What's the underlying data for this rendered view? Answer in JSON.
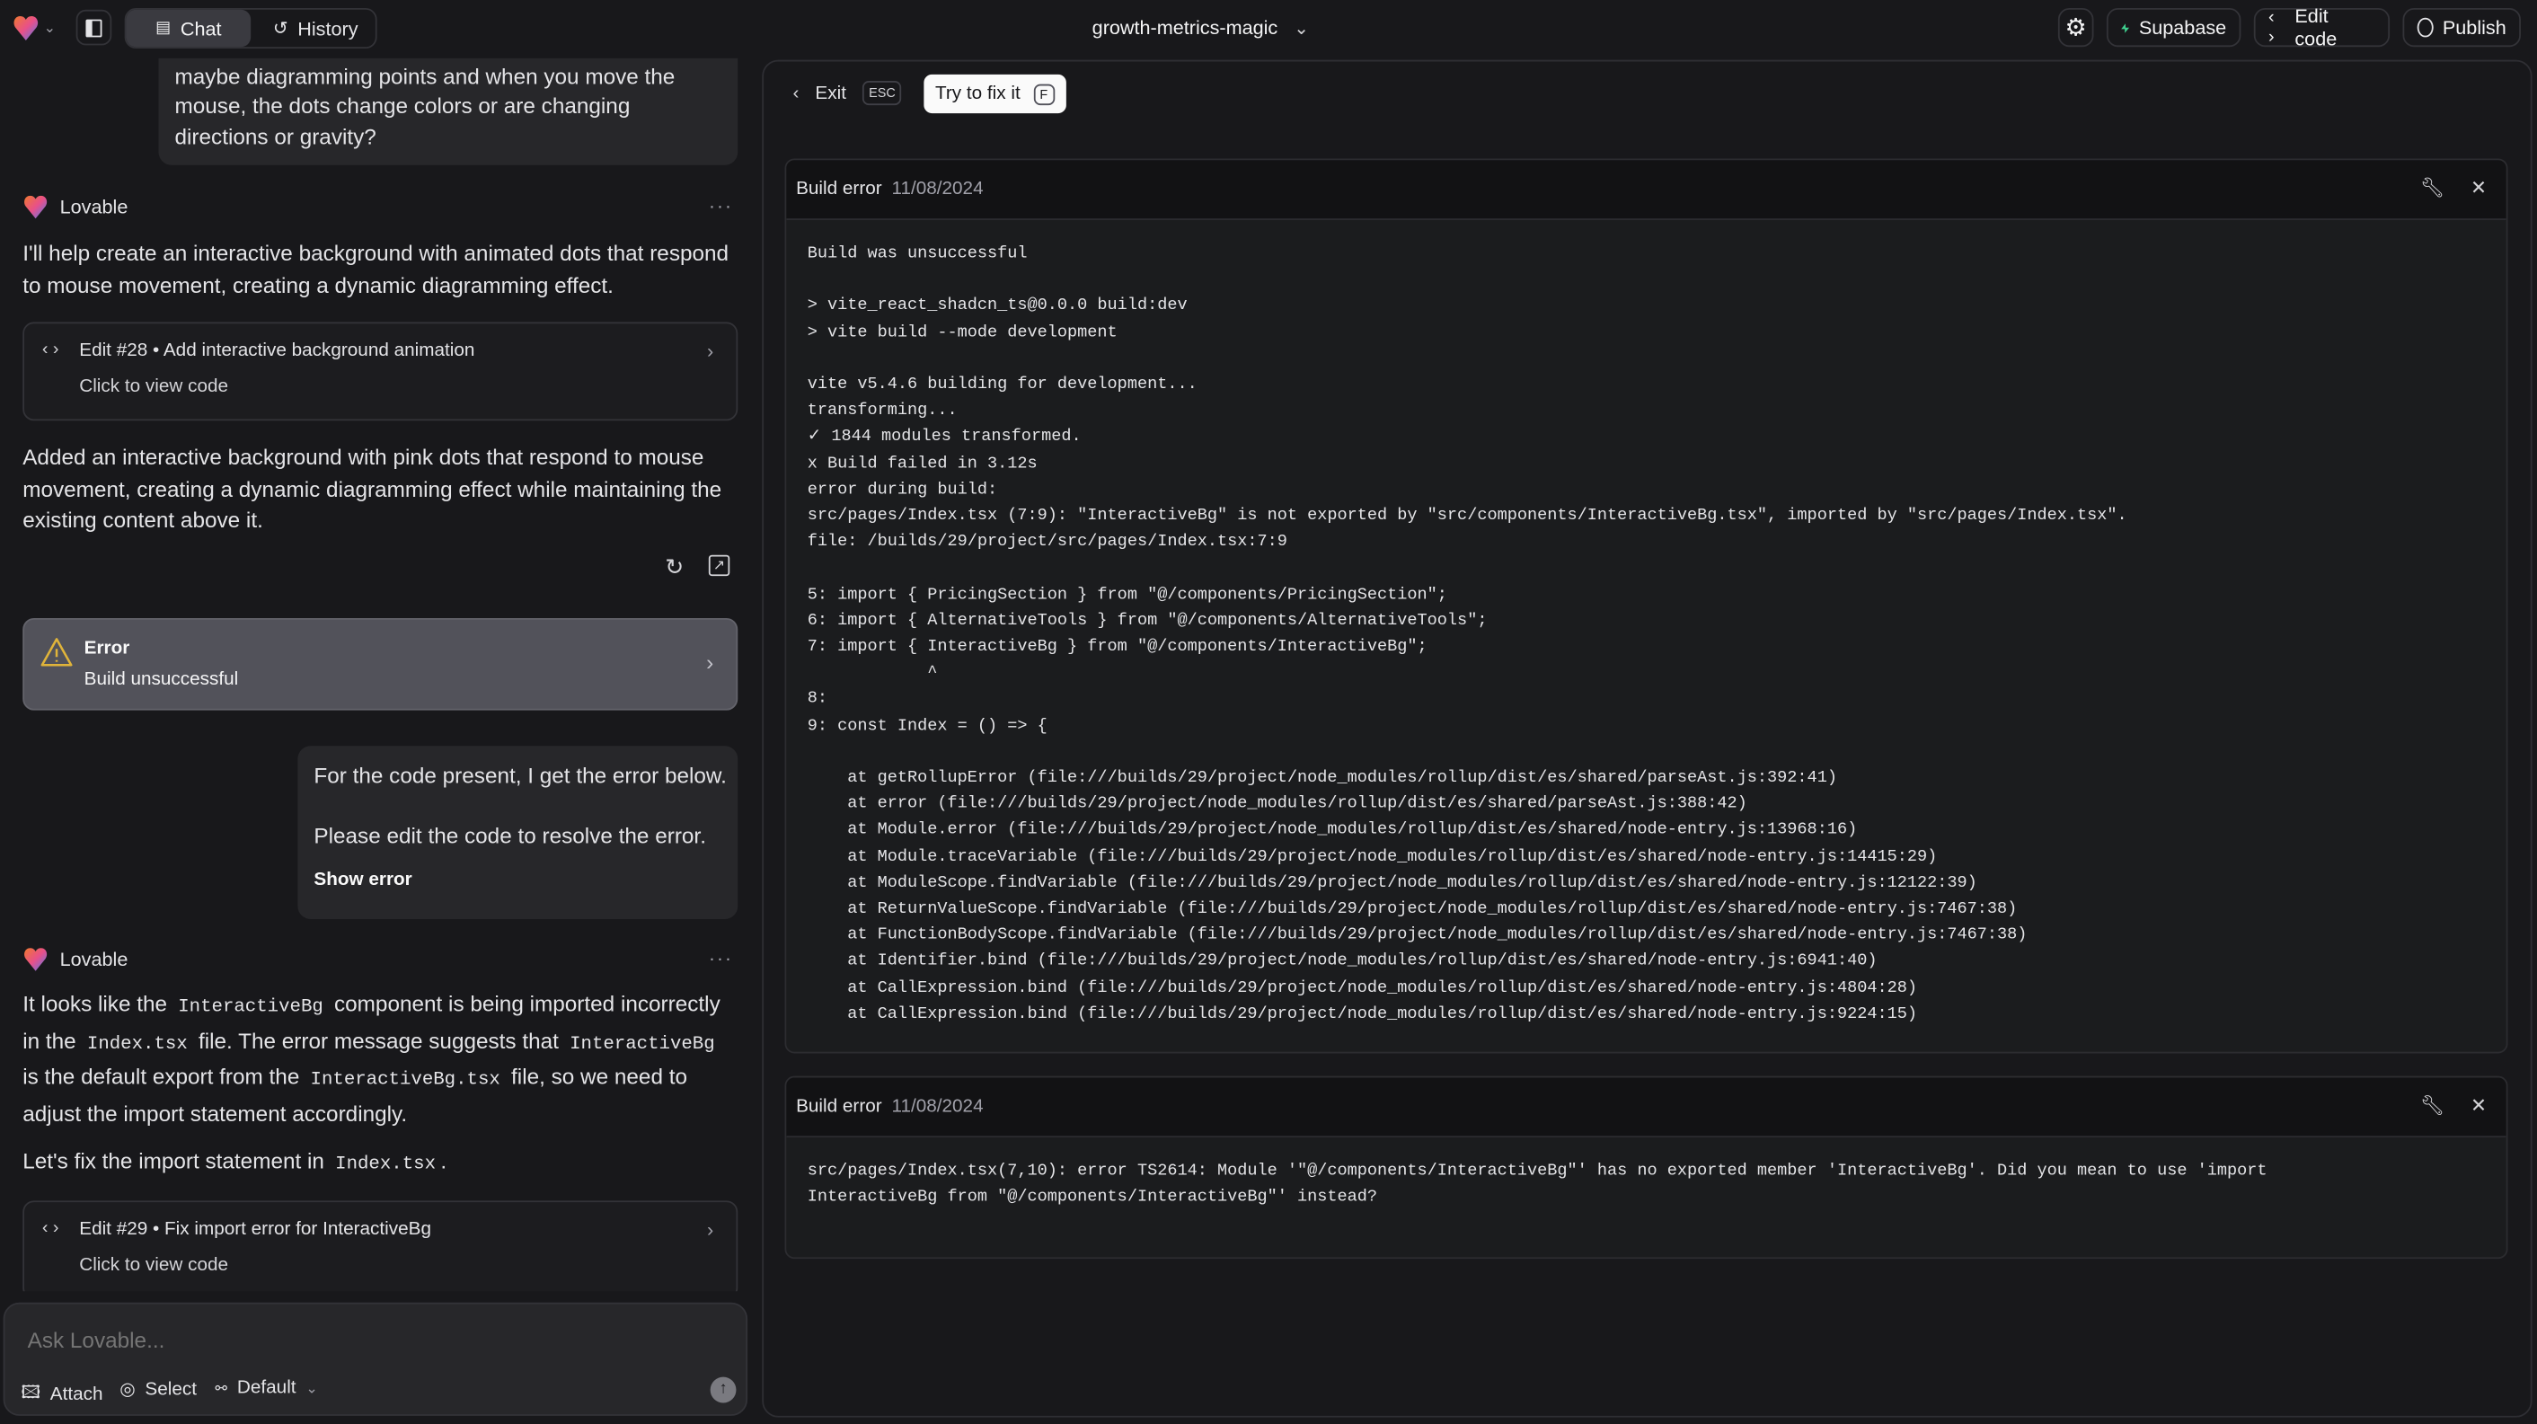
{
  "topbar": {
    "project_name": "growth-metrics-magic",
    "tabs": [
      {
        "label": "Chat",
        "active": true
      },
      {
        "label": "History",
        "active": false
      }
    ],
    "supabase_label": "Supabase",
    "edit_code_label": "Edit code",
    "publish_label": "Publish",
    "colors": {
      "supabase": "#3ecf8e",
      "background": "#18181b"
    }
  },
  "chat": {
    "messages": [
      {
        "role": "user",
        "text_lines": [
          "maybe diagramming points and when you move the",
          "mouse, the dots change colors or are changing",
          "directions or gravity?"
        ]
      },
      {
        "role": "assistant",
        "author": "Lovable",
        "text": "I'll help create an interactive background with animated dots that respond to mouse movement, creating a dynamic diagramming effect.",
        "edit": {
          "title": "Edit #28 • Add interactive background animation",
          "subtitle": "Click to view code"
        },
        "followup": "Added an interactive background with pink dots that respond to mouse movement, creating a dynamic diagramming effect while maintaining the existing content above it."
      },
      {
        "role": "error",
        "title": "Error",
        "subtitle": "Build unsuccessful",
        "color": "#e0b43a"
      },
      {
        "role": "user",
        "line1": "For the code present, I get the error below.",
        "line2": "Please edit the code to resolve the error.",
        "link": "Show error"
      },
      {
        "role": "assistant",
        "author": "Lovable",
        "p1": [
          "It looks like the",
          "InteractiveBg",
          "component is being imported incorrectly in the",
          "Index.tsx",
          "file. The error message suggests that",
          "InteractiveBg",
          "is the default export from the",
          "InteractiveBg.tsx",
          "file, so we need to adjust the import statement accordingly."
        ],
        "p2": [
          "Let's fix the import statement in",
          "Index.tsx",
          "."
        ],
        "edit": {
          "title": "Edit #29 • Fix import error for InteractiveBg",
          "subtitle": "Click to view code"
        }
      }
    ],
    "input": {
      "placeholder": "Ask Lovable...",
      "attach": "Attach",
      "select": "Select",
      "mode": "Default"
    }
  },
  "preview": {
    "exit_label": "Exit",
    "exit_key": "ESC",
    "fix_label": "Try to fix it",
    "fix_key": "F",
    "errors": [
      {
        "title": "Build error",
        "date": "11/08/2024",
        "lines": [
          "Build was unsuccessful",
          "",
          "> vite_react_shadcn_ts@0.0.0 build:dev",
          "> vite build --mode development",
          "",
          "vite v5.4.6 building for development...",
          "transforming...",
          "✓ 1844 modules transformed.",
          "x Build failed in 3.12s",
          "error during build:",
          "src/pages/Index.tsx (7:9): \"InteractiveBg\" is not exported by \"src/components/InteractiveBg.tsx\", imported by \"src/pages/Index.tsx\".",
          "file: /builds/29/project/src/pages/Index.tsx:7:9",
          "",
          "5: import { PricingSection } from \"@/components/PricingSection\";",
          "6: import { AlternativeTools } from \"@/components/AlternativeTools\";",
          "7: import { InteractiveBg } from \"@/components/InteractiveBg\";",
          "            ^",
          "8: ",
          "9: const Index = () => {",
          "",
          "    at getRollupError (file:///builds/29/project/node_modules/rollup/dist/es/shared/parseAst.js:392:41)",
          "    at error (file:///builds/29/project/node_modules/rollup/dist/es/shared/parseAst.js:388:42)",
          "    at Module.error (file:///builds/29/project/node_modules/rollup/dist/es/shared/node-entry.js:13968:16)",
          "    at Module.traceVariable (file:///builds/29/project/node_modules/rollup/dist/es/shared/node-entry.js:14415:29)",
          "    at ModuleScope.findVariable (file:///builds/29/project/node_modules/rollup/dist/es/shared/node-entry.js:12122:39)",
          "    at ReturnValueScope.findVariable (file:///builds/29/project/node_modules/rollup/dist/es/shared/node-entry.js:7467:38)",
          "    at FunctionBodyScope.findVariable (file:///builds/29/project/node_modules/rollup/dist/es/shared/node-entry.js:7467:38)",
          "    at Identifier.bind (file:///builds/29/project/node_modules/rollup/dist/es/shared/node-entry.js:6941:40)",
          "    at CallExpression.bind (file:///builds/29/project/node_modules/rollup/dist/es/shared/node-entry.js:4804:28)",
          "    at CallExpression.bind (file:///builds/29/project/node_modules/rollup/dist/es/shared/node-entry.js:9224:15)"
        ]
      },
      {
        "title": "Build error",
        "date": "11/08/2024",
        "lines": [
          "src/pages/Index.tsx(7,10): error TS2614: Module '\"@/components/InteractiveBg\"' has no exported member 'InteractiveBg'. Did you mean to use 'import",
          "InteractiveBg from \"@/components/InteractiveBg\"' instead?"
        ]
      }
    ]
  }
}
